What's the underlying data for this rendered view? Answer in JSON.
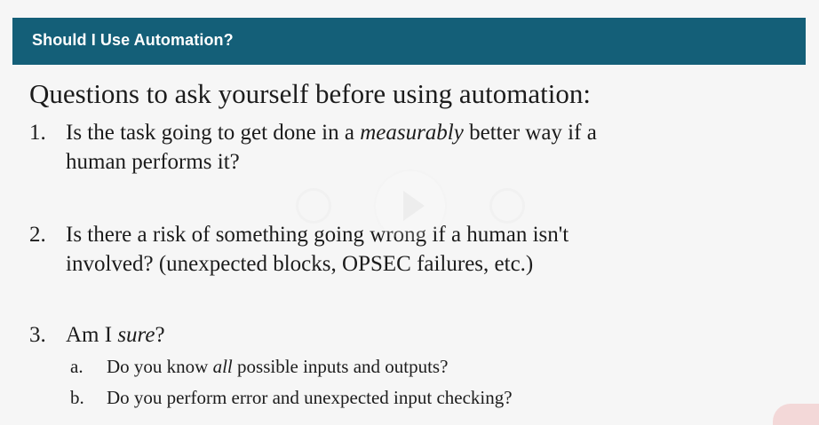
{
  "slide": {
    "title": "Should I Use Automation?",
    "heading": "Questions to ask yourself before using automation:"
  },
  "questions": [
    {
      "number": "1.",
      "line1_before": "Is the task going to get done in a ",
      "line1_em": "measurably",
      "line1_after": " better way if a",
      "line2": "human performs it?"
    },
    {
      "number": "2.",
      "line1": "Is there a risk of something going wrong if a human isn't",
      "line2": "involved? (unexpected blocks, OPSEC failures, etc.)"
    },
    {
      "number": "3.",
      "before": "Am I ",
      "em": "sure",
      "after": "?",
      "sub": [
        {
          "letter": "a.",
          "before": "Do you know ",
          "em": "all",
          "after": " possible inputs and outputs?"
        },
        {
          "letter": "b.",
          "text": "Do you perform error and unexpected input checking?"
        }
      ]
    }
  ],
  "overlay": {
    "icons": [
      "rewind-icon",
      "play-icon",
      "forward-icon"
    ]
  },
  "colors": {
    "header": "#145f78",
    "header_text": "#ffffff",
    "background": "#f6f6f6"
  }
}
